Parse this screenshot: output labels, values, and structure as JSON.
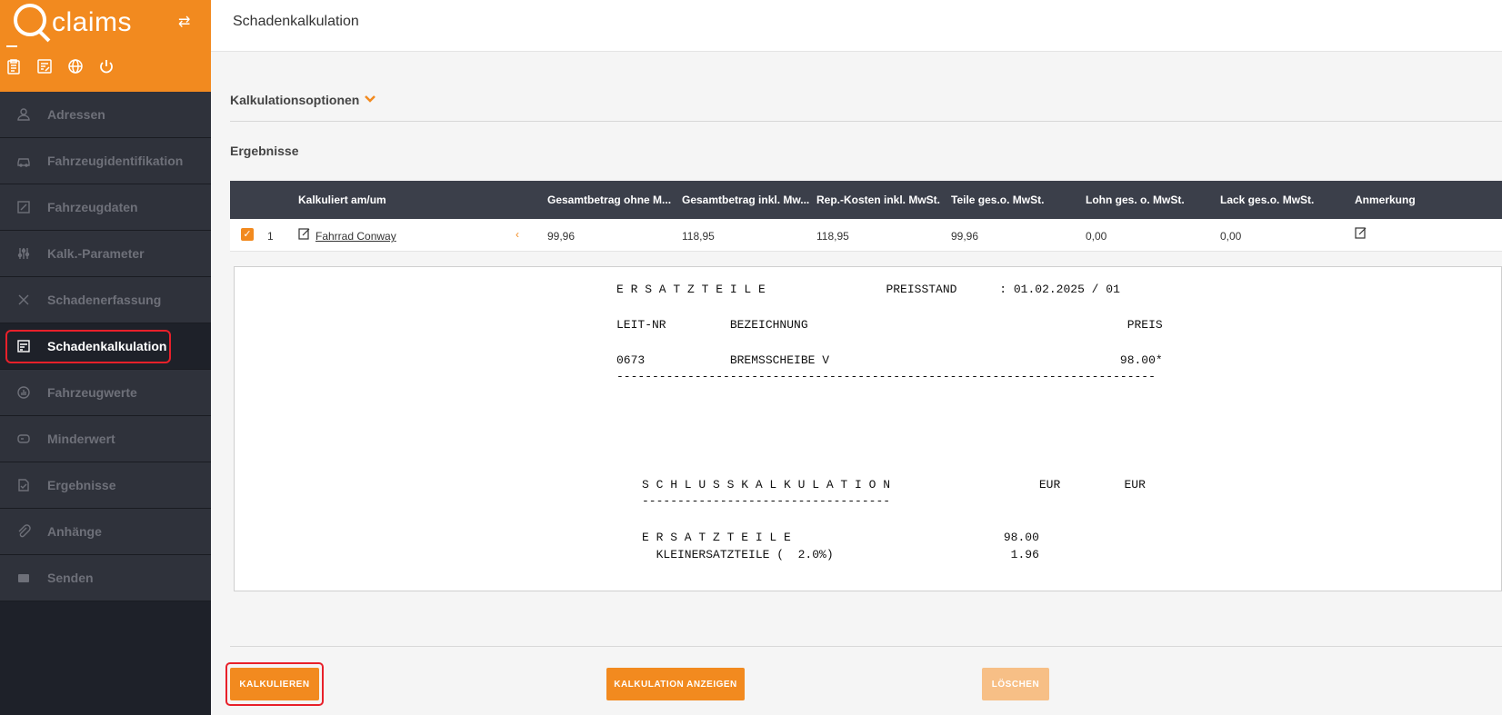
{
  "app": {
    "logo_text": "claims",
    "accent": "#f28a1f",
    "sidebar_bg": "#2f323b"
  },
  "brand_tools": [
    "clipboard-icon",
    "list-edit-icon",
    "globe-icon",
    "power-icon"
  ],
  "sidebar": {
    "items": [
      {
        "label": "Adressen",
        "icon": "person-icon"
      },
      {
        "label": "Fahrzeugidentifikation",
        "icon": "car-icon"
      },
      {
        "label": "Fahrzeugdaten",
        "icon": "edit-icon"
      },
      {
        "label": "Kalk.-Parameter",
        "icon": "sliders-icon"
      },
      {
        "label": "Schadenerfassung",
        "icon": "tools-icon"
      },
      {
        "label": "Schadenkalkulation",
        "icon": "calc-list-icon",
        "active": true
      },
      {
        "label": "Fahrzeugwerte",
        "icon": "gauge-icon"
      },
      {
        "label": "Minderwert",
        "icon": "tag-icon"
      },
      {
        "label": "Ergebnisse",
        "icon": "document-check-icon"
      },
      {
        "label": "Anhänge",
        "icon": "paperclip-icon"
      },
      {
        "label": "Senden",
        "icon": "envelope-icon"
      }
    ]
  },
  "header": {
    "title": "Schadenkalkulation"
  },
  "main": {
    "options_label": "Kalkulationsoptionen",
    "results_label": "Ergebnisse",
    "table": {
      "headers": [
        "Kalkuliert am/um",
        "Gesamtbetrag ohne M...",
        "Gesamtbetrag inkl. Mw...",
        "Rep.-Kosten inkl. MwSt.",
        "Teile ges.o. MwSt.",
        "Lohn ges. o. MwSt.",
        "Lack ges.o. MwSt.",
        "Anmerkung"
      ],
      "rows": [
        {
          "index": "1",
          "name": "Fahrrad Conway",
          "ohne": "99,96",
          "inkl": "118,95",
          "rep": "118,95",
          "teile": "99,96",
          "lohn": "0,00",
          "lack": "0,00",
          "checked": true
        }
      ]
    },
    "report": {
      "line1": "E R S A T Z T E I L E                 PREISSTAND      : 01.02.2025 / 01",
      "line2": "LEIT-NR         BEZEICHNUNG                                             PREIS",
      "line3": "0673            BREMSSCHEIBE V                                         98.00*",
      "line4": "----------------------------------------------------------------------------",
      "line5": "S C H L U S S K A L K U L A T I O N                     EUR         EUR",
      "line6": "-----------------------------------",
      "line7": "E R S A T Z T E I L E                              98.00",
      "line8": "  KLEINERSATZTEILE (  2.0%)                         1.96"
    },
    "buttons": {
      "kalkulieren": "KALKULIEREN",
      "anzeigen": "KALKULATION ANZEIGEN",
      "loeschen": "LÖSCHEN"
    }
  }
}
